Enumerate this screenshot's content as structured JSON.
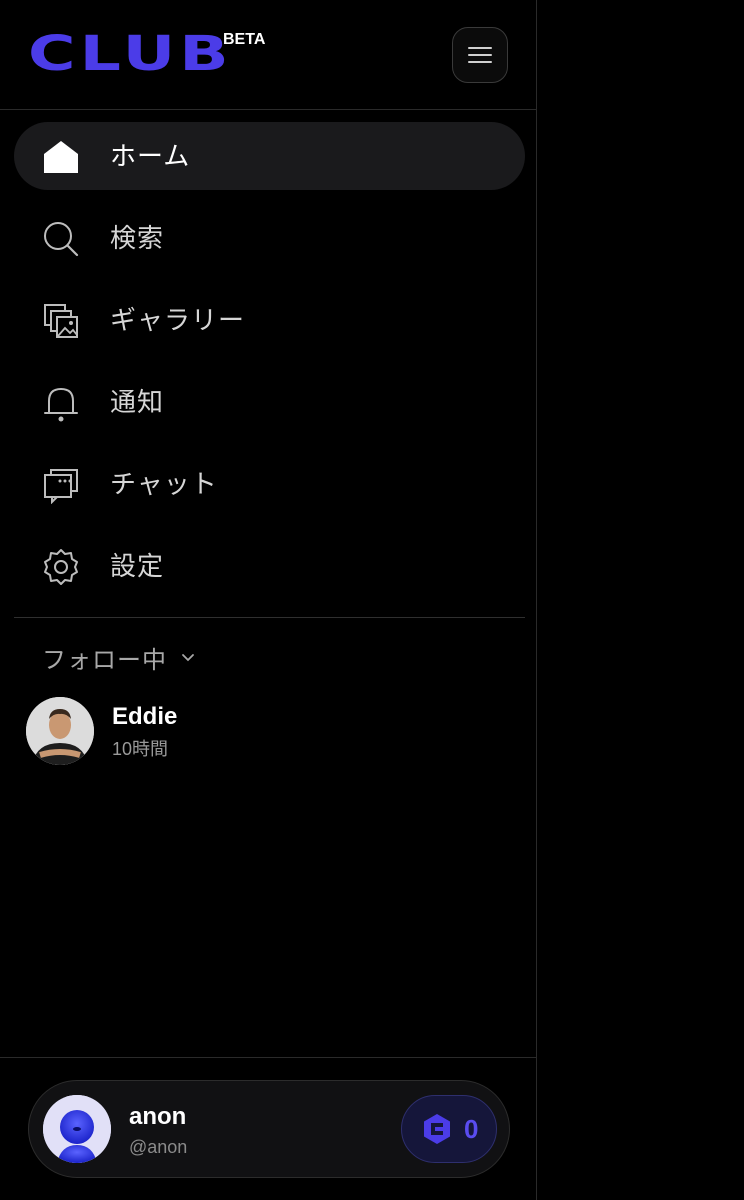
{
  "header": {
    "logo_text": "CLUB",
    "beta_label": "BETA",
    "menu_icon": "hamburger-icon",
    "brand_color": "#4b3ce8"
  },
  "nav": {
    "items": [
      {
        "label": "ホーム",
        "icon": "home-icon",
        "active": true
      },
      {
        "label": "検索",
        "icon": "search-icon",
        "active": false
      },
      {
        "label": "ギャラリー",
        "icon": "gallery-icon",
        "active": false
      },
      {
        "label": "通知",
        "icon": "bell-icon",
        "active": false
      },
      {
        "label": "チャット",
        "icon": "chat-icon",
        "active": false
      },
      {
        "label": "設定",
        "icon": "gear-icon",
        "active": false
      }
    ]
  },
  "following": {
    "label": "フォロー中",
    "users": [
      {
        "name": "Eddie",
        "time": "10時間"
      }
    ]
  },
  "account": {
    "name": "anon",
    "handle": "@anon",
    "credits": "0",
    "accent_color": "#5a4cf0"
  }
}
